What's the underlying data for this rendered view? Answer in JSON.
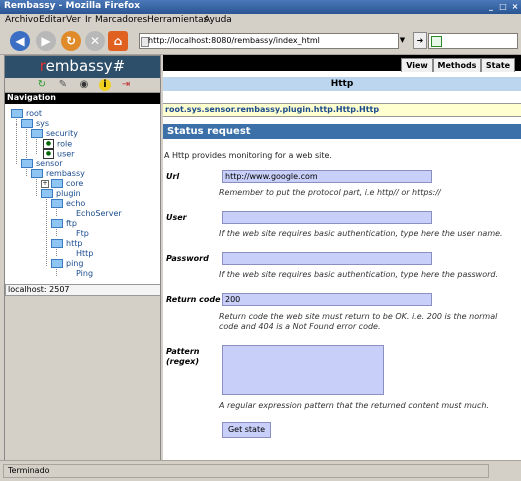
{
  "window": {
    "title": "Rembassy - Mozilla Firefox"
  },
  "menu": [
    "Archivo",
    "Editar",
    "Ver",
    "Ir",
    "Marcadores",
    "Herramientas",
    "Ayuda"
  ],
  "url": "http://localhost:8080/rembassy/index_html",
  "logo": {
    "prefix": "r",
    "name": "embassy",
    "suffix": "#"
  },
  "nav": {
    "header": "Navigation",
    "tree": [
      "root",
      "sys",
      "security",
      "role",
      "user",
      "sensor",
      "rembassy",
      "core",
      "plugin",
      "echo",
      "EchoServer",
      "ftp",
      "Ftp",
      "http",
      "Http",
      "ping",
      "Ping"
    ],
    "host": "localhost: 2507"
  },
  "tabs": [
    "View",
    "Methods",
    "State"
  ],
  "page": {
    "title": "Http",
    "class": "root.sys.sensor.rembassy.plugin.http.Http.Http",
    "section": "Status request",
    "intro": "A Http provides monitoring for a web site.",
    "fields": {
      "url": {
        "label": "Url",
        "value": "http://www.google.com",
        "hint": "Remember to put the protocol part, i.e http// or https://"
      },
      "user": {
        "label": "User",
        "value": "",
        "hint": "If the web site requires basic authentication, type here the user name."
      },
      "password": {
        "label": "Password",
        "value": "",
        "hint": "If the web site requires basic authentication, type here the password."
      },
      "return_code": {
        "label": "Return code",
        "value": "200",
        "hint1": "Return code the web site must return to be OK. i.e. 200 is the normal",
        "hint2": "code and 404 is a Not Found error code."
      },
      "pattern": {
        "label1": "Pattern",
        "label2": "(regex)",
        "hint": "A regular expression pattern that the returned content must much."
      }
    },
    "button": "Get state"
  },
  "status": "Terminado",
  "colors": {
    "title_bar": "#2a5593",
    "section_header": "#3b70a8",
    "input_bg": "#c8cff8",
    "http_bar": "#bcd6ef",
    "class_bar": "#ffffd0"
  }
}
